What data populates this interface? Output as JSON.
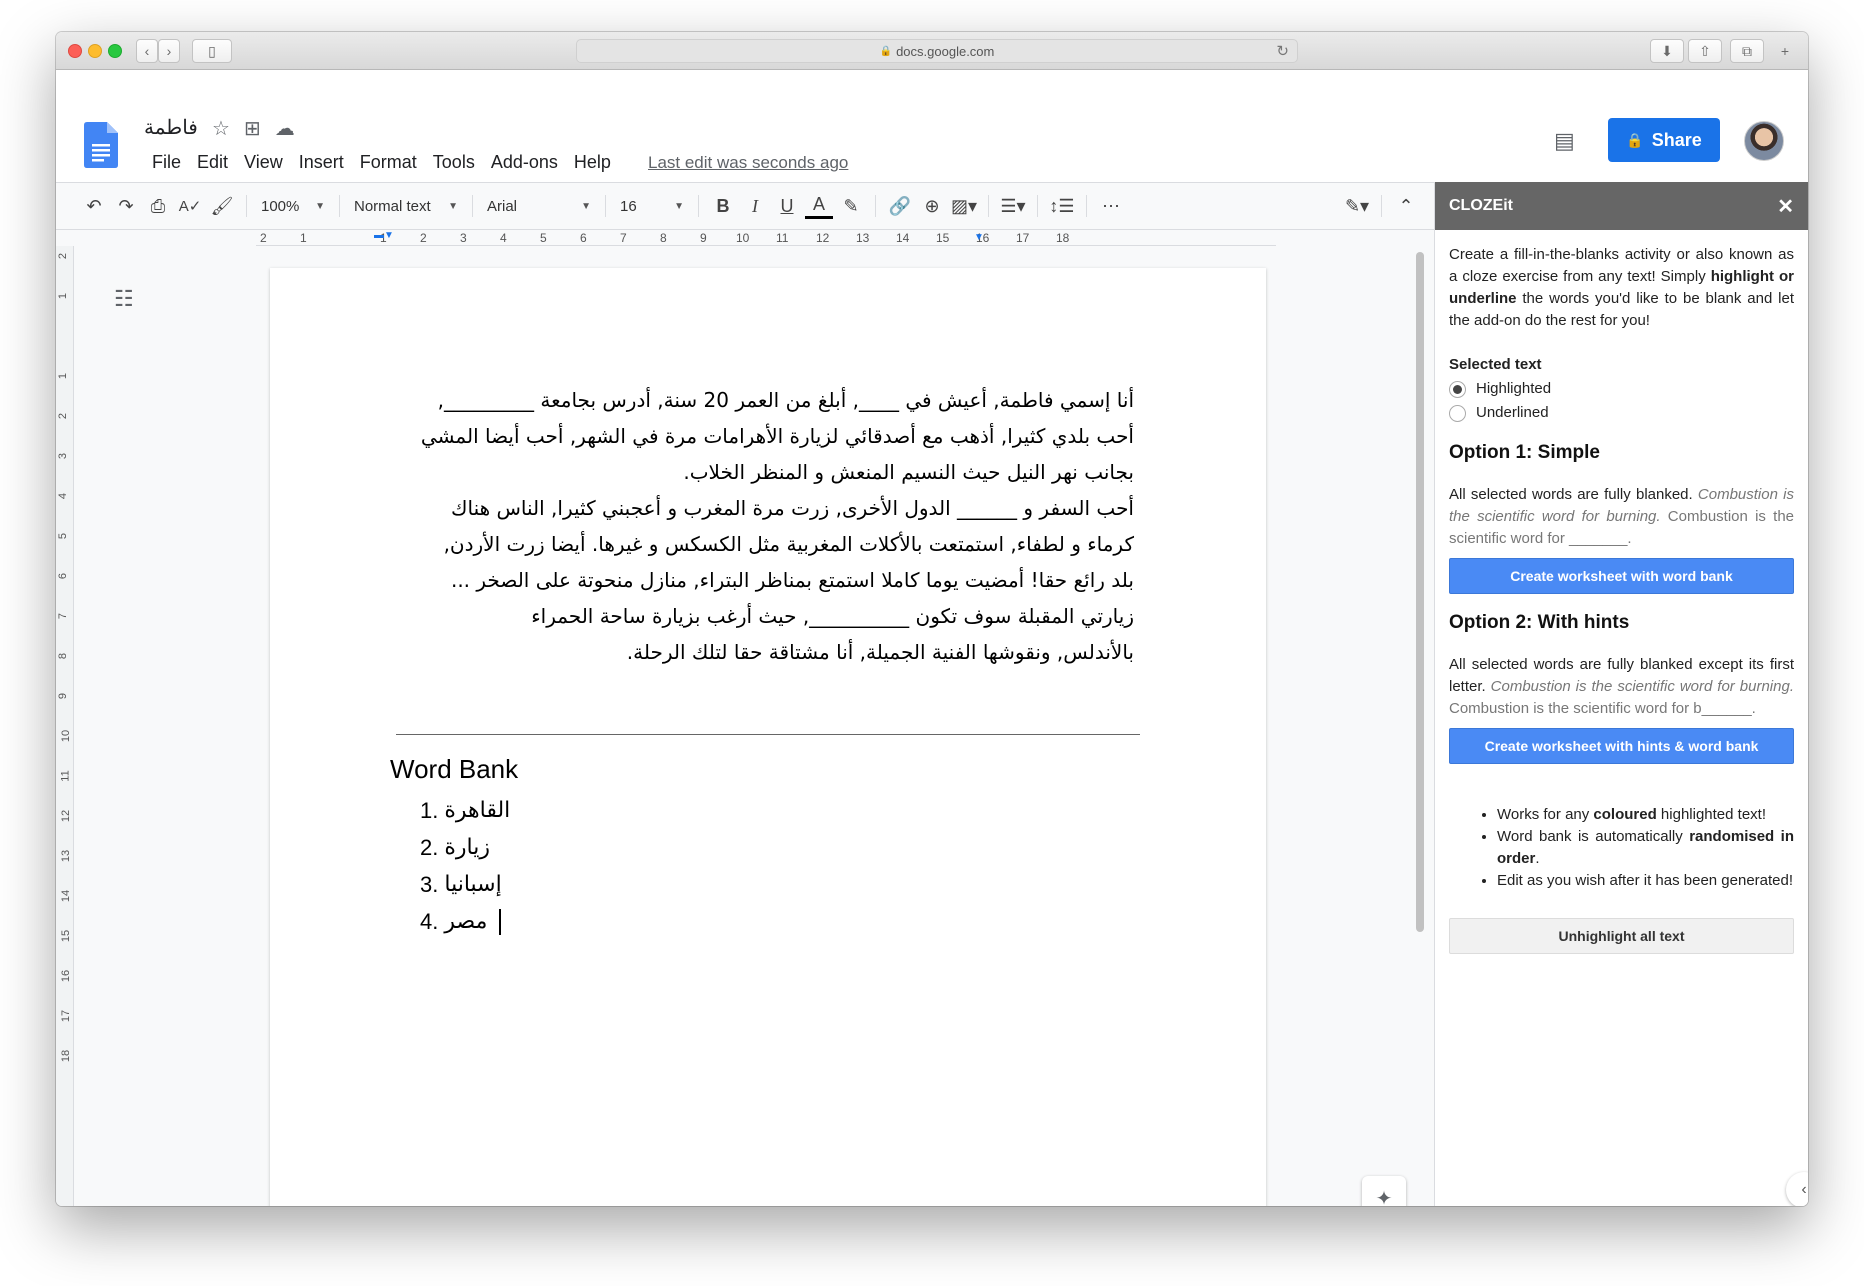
{
  "browser": {
    "url": "docs.google.com"
  },
  "doc": {
    "title": "فاطمة",
    "menu": [
      "File",
      "Edit",
      "View",
      "Insert",
      "Format",
      "Tools",
      "Add-ons",
      "Help"
    ],
    "last_edit": "Last edit was seconds ago",
    "share_label": "Share"
  },
  "toolbar": {
    "zoom": "100%",
    "style": "Normal text",
    "font": "Arial",
    "size": "16"
  },
  "ruler": {
    "marks": [
      "2",
      "1",
      "1",
      "2",
      "3",
      "4",
      "5",
      "6",
      "7",
      "8",
      "9",
      "10",
      "11",
      "12",
      "13",
      "14",
      "15",
      "16",
      "17",
      "18"
    ],
    "vmarks": [
      "2",
      "1",
      "1",
      "2",
      "3",
      "4",
      "5",
      "6",
      "7",
      "8",
      "9",
      "10",
      "11",
      "12",
      "13",
      "14",
      "15",
      "16",
      "17",
      "18"
    ]
  },
  "document": {
    "paragraph_lines": [
      "أنا إسمي فاطمة, أعيش في ____, أبلغ من العمر 20 سنة, أدرس بجامعة _________,",
      "أحب بلدي كثيرا, أذهب مع أصدقائي لزيارة الأهرامات مرة في الشهر, أحب أيضا المشي",
      "بجانب نهر النيل حيث النسيم المنعش و المنظر الخلاب.",
      "أحب السفر و ______ الدول الأخرى, زرت مرة المغرب و أعجبني كثيرا, الناس هناك",
      "كرماء و لطفاء, استمتعت بالأكلات المغربية مثل الكسكس و غيرها. أيضا زرت الأردن,",
      "بلد رائع حقا! أمضيت يوما كاملا استمتع بمناظر البتراء, منازل منحوتة على الصخر ...",
      "زيارتي المقبلة سوف تكون __________, حيث أرغب بزيارة ساحة الحمراء",
      "بالأندلس, ونقوشها الفنية الجميلة, أنا مشتاقة حقا لتلك الرحلة."
    ],
    "word_bank_title": "Word Bank",
    "word_bank": [
      {
        "num": "1.",
        "word": "القاهرة"
      },
      {
        "num": "2.",
        "word": "زيارة"
      },
      {
        "num": "3.",
        "word": "إسبانيا"
      },
      {
        "num": "4.",
        "word": "مصر"
      }
    ]
  },
  "panel": {
    "title": "CLOZEit",
    "intro_1": "Create a fill-in-the-blanks activity or also known as a cloze exercise from any text! Simply ",
    "intro_bold": "highlight or underline",
    "intro_2": " the words you'd like to be blank and let the add-on do the rest for you!",
    "selected_label": "Selected text",
    "radio_1": "Highlighted",
    "radio_2": "Underlined",
    "option1_title": "Option 1: Simple",
    "option1_text": "All selected words are fully blanked. ",
    "option1_example_italic": "Combustion is the scientific word for burning.",
    "option1_example_plain": " Combustion is the scientific word for _______.",
    "option1_button": "Create worksheet with word bank",
    "option2_title": "Option 2: With hints",
    "option2_text": "All selected words are fully blanked except its first letter. ",
    "option2_example_italic": "Combustion is the scientific word for burning.",
    "option2_example_plain": " Combustion is the scientific word for b______.",
    "option2_button": "Create worksheet with hints & word bank",
    "bullet1_a": "Works for any ",
    "bullet1_b": "coloured",
    "bullet1_c": " highlighted text!",
    "bullet2_a": "Word bank is automatically ",
    "bullet2_b": "randomised in order",
    "bullet2_c": ".",
    "bullet3": "Edit as you wish after it has been generated!",
    "unhighlight_button": "Unhighlight all text"
  },
  "colors": {
    "accent": "#1a73e8",
    "panel_button": "#4a8af4",
    "panel_header": "#666666"
  }
}
